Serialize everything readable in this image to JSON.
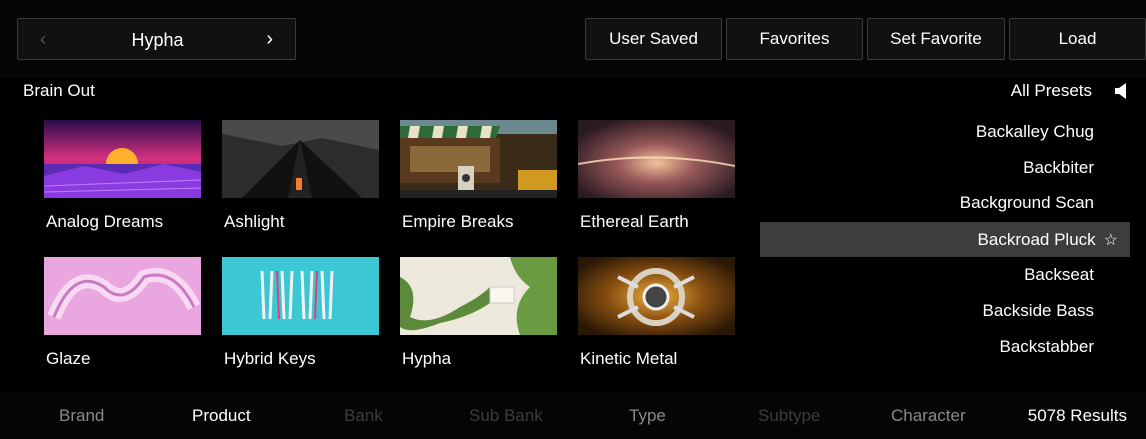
{
  "nav": {
    "prev_icon": "chevron-left-icon",
    "title": "Hypha",
    "next_icon": "chevron-right-icon"
  },
  "toolbar": {
    "user_saved": "User Saved",
    "favorites": "Favorites",
    "set_favorite": "Set Favorite",
    "load": "Load"
  },
  "bank_label": "Brain Out",
  "filter_label": "All Presets",
  "products": [
    {
      "name": "Analog Dreams"
    },
    {
      "name": "Ashlight"
    },
    {
      "name": "Empire Breaks"
    },
    {
      "name": "Ethereal Earth"
    },
    {
      "name": "Glaze"
    },
    {
      "name": "Hybrid Keys"
    },
    {
      "name": "Hypha"
    },
    {
      "name": "Kinetic Metal"
    }
  ],
  "presets": [
    {
      "name": "Backalley Chug",
      "selected": false
    },
    {
      "name": "Backbiter",
      "selected": false
    },
    {
      "name": "Background Scan",
      "selected": false
    },
    {
      "name": "Backroad Pluck",
      "selected": true
    },
    {
      "name": "Backseat",
      "selected": false
    },
    {
      "name": "Backside Bass",
      "selected": false
    },
    {
      "name": "Backstabber",
      "selected": false
    }
  ],
  "star_glyph": "☆",
  "filters": {
    "brand": "Brand",
    "product": "Product",
    "bank": "Bank",
    "sub_bank": "Sub Bank",
    "type": "Type",
    "subtype": "Subtype",
    "character": "Character"
  },
  "results": "5078 Results",
  "colors": {
    "active": "#ffffff",
    "inactive": "#8a8a8a",
    "disabled": "#3c3c3c",
    "selected_row": "#3d3d3d"
  }
}
